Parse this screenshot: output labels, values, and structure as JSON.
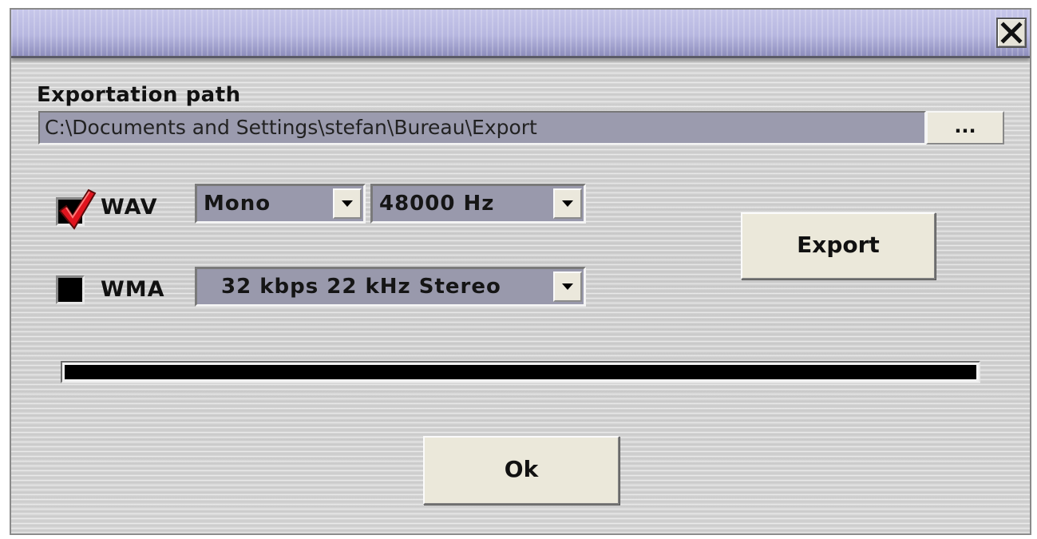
{
  "dialog": {
    "close_glyph": "X",
    "close_icon": "close-icon"
  },
  "export_path": {
    "label": "Exportation path",
    "value": "C:\\Documents and Settings\\stefan\\Bureau\\Export",
    "browse_label": "..."
  },
  "formats": {
    "wav": {
      "label": "WAV",
      "checked": true,
      "channels": "Mono",
      "sample_rate": "48000 Hz"
    },
    "wma": {
      "label": "WMA",
      "checked": false,
      "quality": "32 kbps 22 kHz Stereo"
    }
  },
  "buttons": {
    "export_label": "Export",
    "ok_label": "Ok"
  },
  "progress": {
    "value": 0
  },
  "colors": {
    "checkmark": "#e0141e",
    "field_background": "#9b9bae",
    "button_face": "#ebe8da",
    "titlebar": "#b7b7e0"
  }
}
